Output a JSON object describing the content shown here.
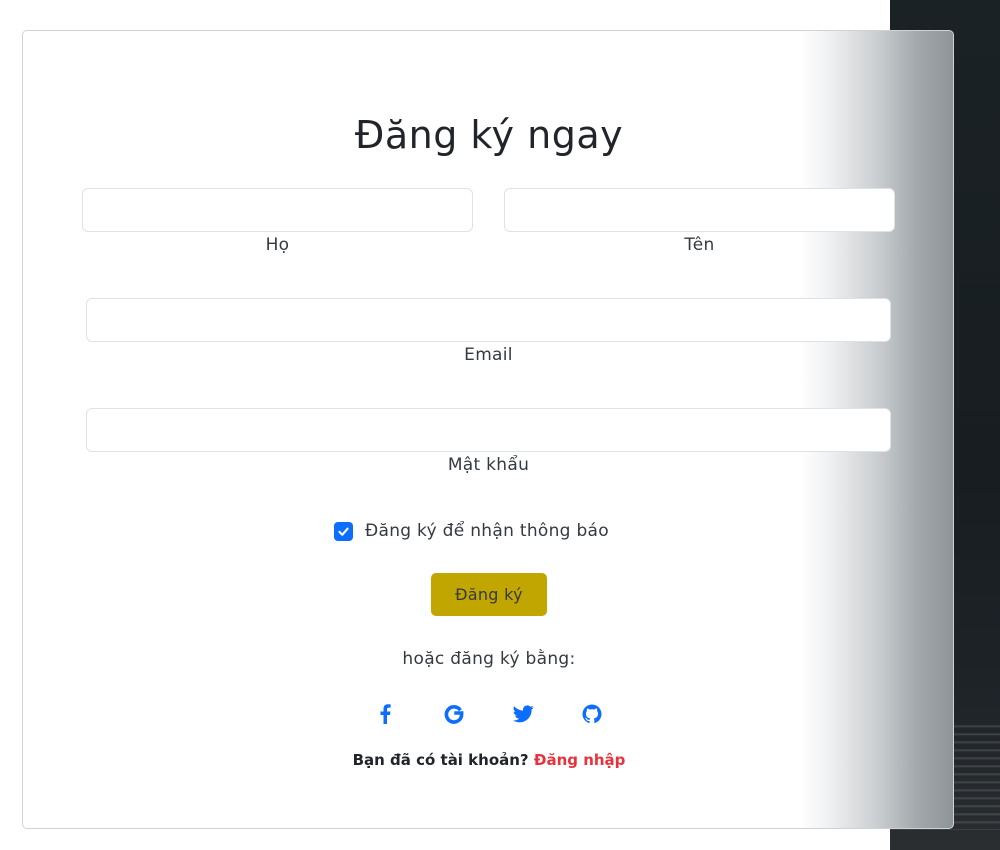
{
  "form": {
    "title": "Đăng ký ngay",
    "fields": {
      "last_name": {
        "label": "Họ",
        "value": ""
      },
      "first_name": {
        "label": "Tên",
        "value": ""
      },
      "email": {
        "label": "Email",
        "value": ""
      },
      "password": {
        "label": "Mật khẩu",
        "value": ""
      }
    },
    "newsletter": {
      "label": "Đăng ký để nhận thông báo",
      "checked": true
    },
    "submit_label": "Đăng ký",
    "alt_signup_text": "hoặc đăng ký bằng:",
    "social_buttons": [
      {
        "icon": "facebook-icon"
      },
      {
        "icon": "google-icon"
      },
      {
        "icon": "twitter-icon"
      },
      {
        "icon": "github-icon"
      }
    ],
    "login_prompt": "Bạn đã có tài khoản?",
    "login_link": "Đăng nhập"
  },
  "colors": {
    "accent_blue": "#0d6efd",
    "submit_bg": "#c2a600",
    "login_link": "#e8323c",
    "text": "#343a40"
  }
}
